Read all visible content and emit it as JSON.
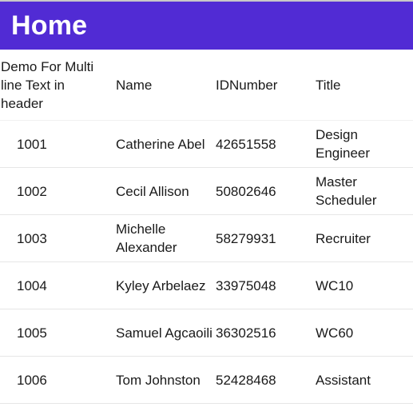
{
  "header": {
    "title": "Home",
    "background": "#512bd4"
  },
  "table": {
    "columns": [
      "Demo For Multi line Text in header",
      "Name",
      "IDNumber",
      "Title"
    ],
    "rows": [
      {
        "id": "1001",
        "name": "Catherine Abel",
        "id_number": "42651558",
        "title": "Design Engineer"
      },
      {
        "id": "1002",
        "name": "Cecil Allison",
        "id_number": "50802646",
        "title": "Master Scheduler"
      },
      {
        "id": "1003",
        "name": "Michelle Alexander",
        "id_number": "58279931",
        "title": "Recruiter"
      },
      {
        "id": "1004",
        "name": "Kyley Arbelaez",
        "id_number": "33975048",
        "title": "WC10"
      },
      {
        "id": "1005",
        "name": "Samuel Agcaoili",
        "id_number": "36302516",
        "title": "WC60"
      },
      {
        "id": "1006",
        "name": "Tom Johnston",
        "id_number": "52428468",
        "title": "Assistant"
      }
    ]
  }
}
